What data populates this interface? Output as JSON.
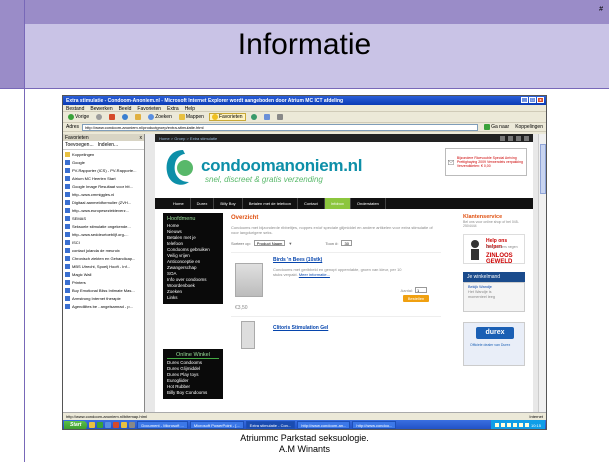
{
  "slide": {
    "title": "Informatie",
    "number": "#",
    "footer_line1": "Atriummc Parkstad seksuologie.",
    "footer_line2": "A.M Winants"
  },
  "browser": {
    "window_title": "Extra stimulatie - Condoom-Anoniem.nl - Microsoft Internet Explorer wordt aangeboden door Atrium MC ICT afdeling",
    "menu": [
      "Bestand",
      "Bewerken",
      "Beeld",
      "Favorieten",
      "Extra",
      "Help"
    ],
    "toolbar": {
      "back": "Vorige",
      "search": "Zoeken",
      "favorites_btn": "Favorieten",
      "folders": "Mappen"
    },
    "address_label": "Adres",
    "address": "http://www.condoom-anoniem.nl/productgroep/extra-stimulatie.html",
    "go_label": "Ga naar",
    "links_label": "Koppelingen",
    "favorites": {
      "title": "Favorieten",
      "tool_add": "Toevoegen...",
      "tool_organize": "Indelen...",
      "items": [
        {
          "label": "Koppelingen",
          "folder": true
        },
        {
          "label": "Google",
          "folder": false
        },
        {
          "label": "PV-Rapporter (ICS) - PV-Rapporte...",
          "folder": false
        },
        {
          "label": "Atrium MC Heerlen  Start",
          "folder": false
        },
        {
          "label": "Google Image Resultaat voor htt...",
          "folder": false
        },
        {
          "label": "http--www.cmmiggles.nl",
          "folder": false
        },
        {
          "label": "Digitaal aanmeldformulier (ZVH...",
          "folder": false
        },
        {
          "label": "http--www.europeseziekteverz...",
          "folder": false
        },
        {
          "label": "SEMAS",
          "folder": false
        },
        {
          "label": "Seksuele stimulatie ongekende...",
          "folder": false
        },
        {
          "label": "http--www.seddeurtoeblijf.org-...",
          "folder": false
        },
        {
          "label": "ISCI",
          "folder": false
        },
        {
          "label": "contact jolanda de meuroix",
          "folder": false
        },
        {
          "label": "Chronisch ziekten en Gehandicap...",
          "folder": false
        },
        {
          "label": "MBS Utrecht, Spoelj Hooft - Inf...",
          "folder": false
        },
        {
          "label": "Magic Wall",
          "folder": false
        },
        {
          "label": "Printers",
          "folder": false
        },
        {
          "label": "Buy Emotional Bliss Intimate Mas...",
          "folder": false
        },
        {
          "label": "Armstrong Internet therapie",
          "folder": false
        },
        {
          "label": "Agendilites be - angelsamrad - p...",
          "folder": false
        }
      ]
    },
    "site": {
      "breadcrumb": "Home > Groep > Extra stimulatie",
      "logo_name": "condoomanoniem.nl",
      "tagline": "snel, discreet & gratis verzending",
      "promo": "Bijzondere Ricevouble Special Arriving Prettighaying 2009 Verwendeis verpakking Verzendkleten: € 0,00",
      "nav": [
        "Home",
        "Durex",
        "Billy Boy",
        "Betalen met de telefoon",
        "Contact",
        "Infobox",
        "Onderstaten"
      ],
      "nav_active_index": 5,
      "leftnav_title": "Hoofdmenu",
      "leftnav_items": [
        "Home",
        "Nieuws",
        "Betalen met je",
        "telefoon",
        "Condooms gebruiken",
        "Veilig vrijen",
        "Anticonceptie en",
        "Zwangerschap",
        "SOA",
        "Info over condooms",
        "Woordenboek",
        "Zoeken",
        "Links"
      ],
      "leftnav2_title": "Online Winkel",
      "leftnav2_items": [
        "Durex Condooms",
        "Durex Glijmiddel",
        "Durex Play toys",
        "Eurogliider",
        "Hot Rubber",
        "Billy Boy Condooms"
      ],
      "overview_title": "Overzicht",
      "intro": "Condooms met bijzonderde ribbeltjes, noppes en/of speciale glijmiddel en andere artikelen voor extra stimulatie of voor langdurigere seks.",
      "sort_label": "Sorteer op:",
      "sort_value": "Product Naam",
      "show_label": "Toon #:",
      "show_value": "30",
      "product1": {
        "name": "Birds 'n Bees (10stk)",
        "desc": "Condooms met geribbeld en genopt oppervlakte, groen van kleur, per 10 stuks verpakt.",
        "more": "Meer informatie...",
        "qty_label": "Aantal:",
        "qty": "1",
        "price": "€3,50",
        "buy": "Bestellen"
      },
      "product2_name": "Clitoris Stimulation Gel",
      "klanten_title": "Klantenservice",
      "klanten_text": "Bel ons voor online shop of bel 045-2504444",
      "hulp_t1": "Help ons helpen",
      "hulp_t2": "Steun anders negen",
      "hulp_t3": "ZINLOOS GEWELD",
      "winkelmand_title": "Je winkelmand",
      "winkelmand_text": [
        "Bekijk Wandje",
        "Het Wandje is",
        "momenteel leeg"
      ],
      "durex_badge": "durex",
      "durex_text": "Officiele dealer van Durex"
    },
    "status_url": "http://www.condoom-anoniem.nl/bitemap.html",
    "status_zone": "Internet",
    "taskbar": {
      "start": "Start",
      "tasks": [
        "Document - Microsoft ...",
        "Microsoft PowerPoint - [...",
        "Extra stimulatie - Con...",
        "http://www.condoom-an...",
        "http://www.condoo..."
      ],
      "active_index": 2,
      "clock": "10:15"
    }
  }
}
